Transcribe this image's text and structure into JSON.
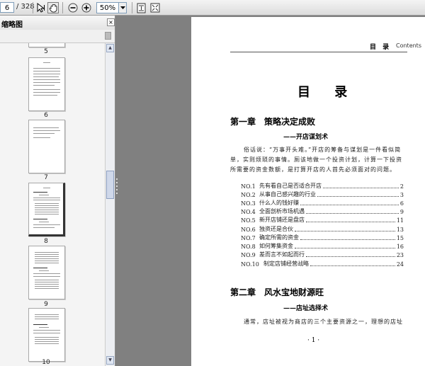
{
  "toolbar": {
    "page_current": "6",
    "page_total": "/ 328",
    "zoom": "50%",
    "icons": [
      "select-cursor-icon",
      "hand-tool-icon",
      "zoom-out-icon",
      "zoom-in-icon",
      "zoom-dropdown-icon",
      "fit-page-icon",
      "fit-width-icon"
    ]
  },
  "sidebar": {
    "title": "缩略图",
    "close": "×",
    "thumbnails": [
      "5",
      "6",
      "7",
      "8",
      "9",
      "10"
    ]
  },
  "document": {
    "header_tag": "目 录",
    "header_contents": "Contents",
    "title": "目 录",
    "chapter1": {
      "title": "第一章　策略决定成败",
      "subtitle": "——开店谋划术",
      "paragraph_lines": [
        "俗话说：“万事开头难。”开店的筹备与谋划是一件看似简",
        "单，实则烦琐的事情。厕该地做一个投资计划，计算一下投资",
        "所需要的资金数额，是打算开店的人首先必须面对的问题。"
      ],
      "toc": [
        {
          "num": "NO.1",
          "text": "先有看自己是否适合开店",
          "page": "2"
        },
        {
          "num": "NO.2",
          "text": "从事自己感兴趣的行业",
          "page": "3"
        },
        {
          "num": "NO.3",
          "text": "什么人的钱好赚",
          "page": "6"
        },
        {
          "num": "NO.4",
          "text": "全面剖析市场机遇",
          "page": "9"
        },
        {
          "num": "NO.5",
          "text": "新开店铺还是盘店",
          "page": "11"
        },
        {
          "num": "NO.6",
          "text": "独资还是合伙",
          "page": "13"
        },
        {
          "num": "NO.7",
          "text": "确定所需的资金",
          "page": "15"
        },
        {
          "num": "NO.8",
          "text": "如何筹集资金",
          "page": "16"
        },
        {
          "num": "NO.9",
          "text": "差而言不如起而行",
          "page": "23"
        },
        {
          "num": "NO.10",
          "text": "制定店铺经营战略",
          "page": "24"
        }
      ]
    },
    "chapter2": {
      "title": "第二章　风水宝地财源旺",
      "subtitle": "——店址选择术",
      "paragraph": "通常，店址被视为商店的三个主要资源之一，理想的店址"
    },
    "page_number": "· 1 ·"
  }
}
